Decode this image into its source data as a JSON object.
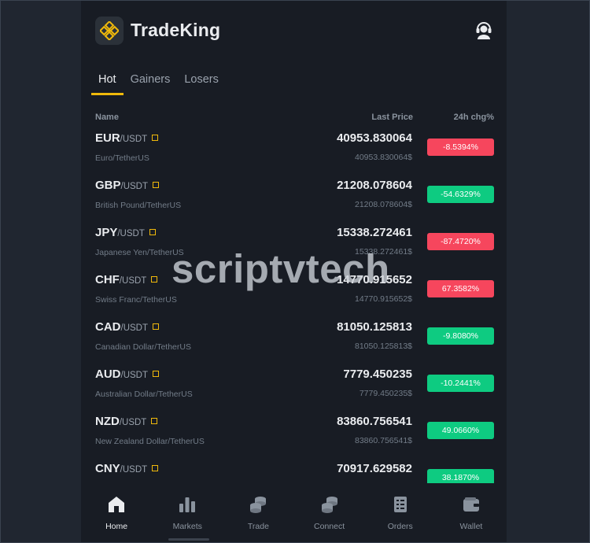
{
  "app": {
    "name": "TradeKing"
  },
  "colors": {
    "accent": "#f0b90b",
    "up": "#0ecb81",
    "down": "#f6465d"
  },
  "tabs": [
    {
      "label": "Hot",
      "active": true
    },
    {
      "label": "Gainers",
      "active": false
    },
    {
      "label": "Losers",
      "active": false
    }
  ],
  "columns": {
    "name": "Name",
    "price": "Last Price",
    "change": "24h chg%"
  },
  "pairs": [
    {
      "base": "EUR",
      "quote": "/USDT",
      "full": "Euro/TetherUS",
      "price": "40953.830064",
      "sub": "40953.830064$",
      "change": "-8.5394%",
      "dir": "down"
    },
    {
      "base": "GBP",
      "quote": "/USDT",
      "full": "British Pound/TetherUS",
      "price": "21208.078604",
      "sub": "21208.078604$",
      "change": "-54.6329%",
      "dir": "up"
    },
    {
      "base": "JPY",
      "quote": "/USDT",
      "full": "Japanese Yen/TetherUS",
      "price": "15338.272461",
      "sub": "15338.272461$",
      "change": "-87.4720%",
      "dir": "down"
    },
    {
      "base": "CHF",
      "quote": "/USDT",
      "full": "Swiss Franc/TetherUS",
      "price": "14770.915652",
      "sub": "14770.915652$",
      "change": "67.3582%",
      "dir": "down"
    },
    {
      "base": "CAD",
      "quote": "/USDT",
      "full": "Canadian Dollar/TetherUS",
      "price": "81050.125813",
      "sub": "81050.125813$",
      "change": "-9.8080%",
      "dir": "up"
    },
    {
      "base": "AUD",
      "quote": "/USDT",
      "full": "Australian Dollar/TetherUS",
      "price": "7779.450235",
      "sub": "7779.450235$",
      "change": "-10.2441%",
      "dir": "up"
    },
    {
      "base": "NZD",
      "quote": "/USDT",
      "full": "New Zealand Dollar/TetherUS",
      "price": "83860.756541",
      "sub": "83860.756541$",
      "change": "49.0660%",
      "dir": "up"
    },
    {
      "base": "CNY",
      "quote": "/USDT",
      "full": "",
      "price": "70917.629582",
      "sub": "",
      "change": "38.1870%",
      "dir": "up"
    }
  ],
  "watermark": "scriptvtech",
  "nav": [
    {
      "label": "Home",
      "icon": "home-icon",
      "active": true
    },
    {
      "label": "Markets",
      "icon": "bar-chart-icon",
      "active": false
    },
    {
      "label": "Trade",
      "icon": "coins-icon",
      "active": false
    },
    {
      "label": "Connect",
      "icon": "coins-stack-icon",
      "active": false
    },
    {
      "label": "Orders",
      "icon": "orders-icon",
      "active": false
    },
    {
      "label": "Wallet",
      "icon": "wallet-icon",
      "active": false
    }
  ]
}
